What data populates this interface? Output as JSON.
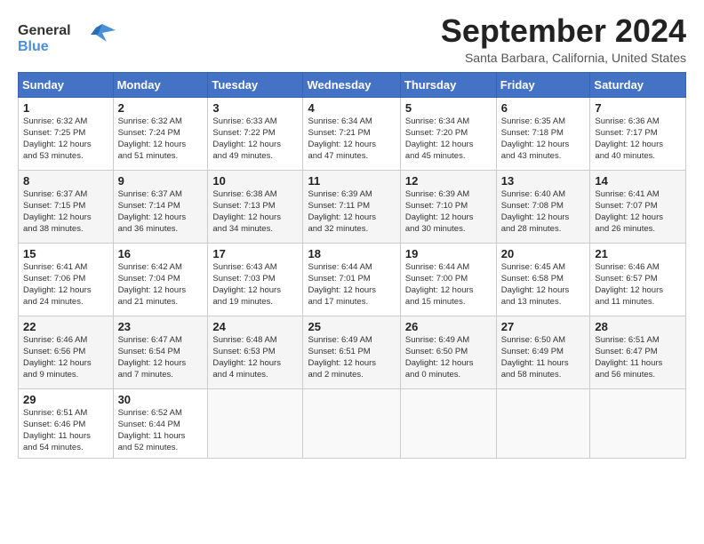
{
  "header": {
    "logo_line1": "General",
    "logo_line2": "Blue",
    "month_title": "September 2024",
    "location": "Santa Barbara, California, United States"
  },
  "days_of_week": [
    "Sunday",
    "Monday",
    "Tuesday",
    "Wednesday",
    "Thursday",
    "Friday",
    "Saturday"
  ],
  "weeks": [
    [
      {
        "day": "1",
        "sunrise": "6:32 AM",
        "sunset": "7:25 PM",
        "daylight": "12 hours and 53 minutes."
      },
      {
        "day": "2",
        "sunrise": "6:32 AM",
        "sunset": "7:24 PM",
        "daylight": "12 hours and 51 minutes."
      },
      {
        "day": "3",
        "sunrise": "6:33 AM",
        "sunset": "7:22 PM",
        "daylight": "12 hours and 49 minutes."
      },
      {
        "day": "4",
        "sunrise": "6:34 AM",
        "sunset": "7:21 PM",
        "daylight": "12 hours and 47 minutes."
      },
      {
        "day": "5",
        "sunrise": "6:34 AM",
        "sunset": "7:20 PM",
        "daylight": "12 hours and 45 minutes."
      },
      {
        "day": "6",
        "sunrise": "6:35 AM",
        "sunset": "7:18 PM",
        "daylight": "12 hours and 43 minutes."
      },
      {
        "day": "7",
        "sunrise": "6:36 AM",
        "sunset": "7:17 PM",
        "daylight": "12 hours and 40 minutes."
      }
    ],
    [
      {
        "day": "8",
        "sunrise": "6:37 AM",
        "sunset": "7:15 PM",
        "daylight": "12 hours and 38 minutes."
      },
      {
        "day": "9",
        "sunrise": "6:37 AM",
        "sunset": "7:14 PM",
        "daylight": "12 hours and 36 minutes."
      },
      {
        "day": "10",
        "sunrise": "6:38 AM",
        "sunset": "7:13 PM",
        "daylight": "12 hours and 34 minutes."
      },
      {
        "day": "11",
        "sunrise": "6:39 AM",
        "sunset": "7:11 PM",
        "daylight": "12 hours and 32 minutes."
      },
      {
        "day": "12",
        "sunrise": "6:39 AM",
        "sunset": "7:10 PM",
        "daylight": "12 hours and 30 minutes."
      },
      {
        "day": "13",
        "sunrise": "6:40 AM",
        "sunset": "7:08 PM",
        "daylight": "12 hours and 28 minutes."
      },
      {
        "day": "14",
        "sunrise": "6:41 AM",
        "sunset": "7:07 PM",
        "daylight": "12 hours and 26 minutes."
      }
    ],
    [
      {
        "day": "15",
        "sunrise": "6:41 AM",
        "sunset": "7:06 PM",
        "daylight": "12 hours and 24 minutes."
      },
      {
        "day": "16",
        "sunrise": "6:42 AM",
        "sunset": "7:04 PM",
        "daylight": "12 hours and 21 minutes."
      },
      {
        "day": "17",
        "sunrise": "6:43 AM",
        "sunset": "7:03 PM",
        "daylight": "12 hours and 19 minutes."
      },
      {
        "day": "18",
        "sunrise": "6:44 AM",
        "sunset": "7:01 PM",
        "daylight": "12 hours and 17 minutes."
      },
      {
        "day": "19",
        "sunrise": "6:44 AM",
        "sunset": "7:00 PM",
        "daylight": "12 hours and 15 minutes."
      },
      {
        "day": "20",
        "sunrise": "6:45 AM",
        "sunset": "6:58 PM",
        "daylight": "12 hours and 13 minutes."
      },
      {
        "day": "21",
        "sunrise": "6:46 AM",
        "sunset": "6:57 PM",
        "daylight": "12 hours and 11 minutes."
      }
    ],
    [
      {
        "day": "22",
        "sunrise": "6:46 AM",
        "sunset": "6:56 PM",
        "daylight": "12 hours and 9 minutes."
      },
      {
        "day": "23",
        "sunrise": "6:47 AM",
        "sunset": "6:54 PM",
        "daylight": "12 hours and 7 minutes."
      },
      {
        "day": "24",
        "sunrise": "6:48 AM",
        "sunset": "6:53 PM",
        "daylight": "12 hours and 4 minutes."
      },
      {
        "day": "25",
        "sunrise": "6:49 AM",
        "sunset": "6:51 PM",
        "daylight": "12 hours and 2 minutes."
      },
      {
        "day": "26",
        "sunrise": "6:49 AM",
        "sunset": "6:50 PM",
        "daylight": "12 hours and 0 minutes."
      },
      {
        "day": "27",
        "sunrise": "6:50 AM",
        "sunset": "6:49 PM",
        "daylight": "11 hours and 58 minutes."
      },
      {
        "day": "28",
        "sunrise": "6:51 AM",
        "sunset": "6:47 PM",
        "daylight": "11 hours and 56 minutes."
      }
    ],
    [
      {
        "day": "29",
        "sunrise": "6:51 AM",
        "sunset": "6:46 PM",
        "daylight": "11 hours and 54 minutes."
      },
      {
        "day": "30",
        "sunrise": "6:52 AM",
        "sunset": "6:44 PM",
        "daylight": "11 hours and 52 minutes."
      },
      null,
      null,
      null,
      null,
      null
    ]
  ]
}
